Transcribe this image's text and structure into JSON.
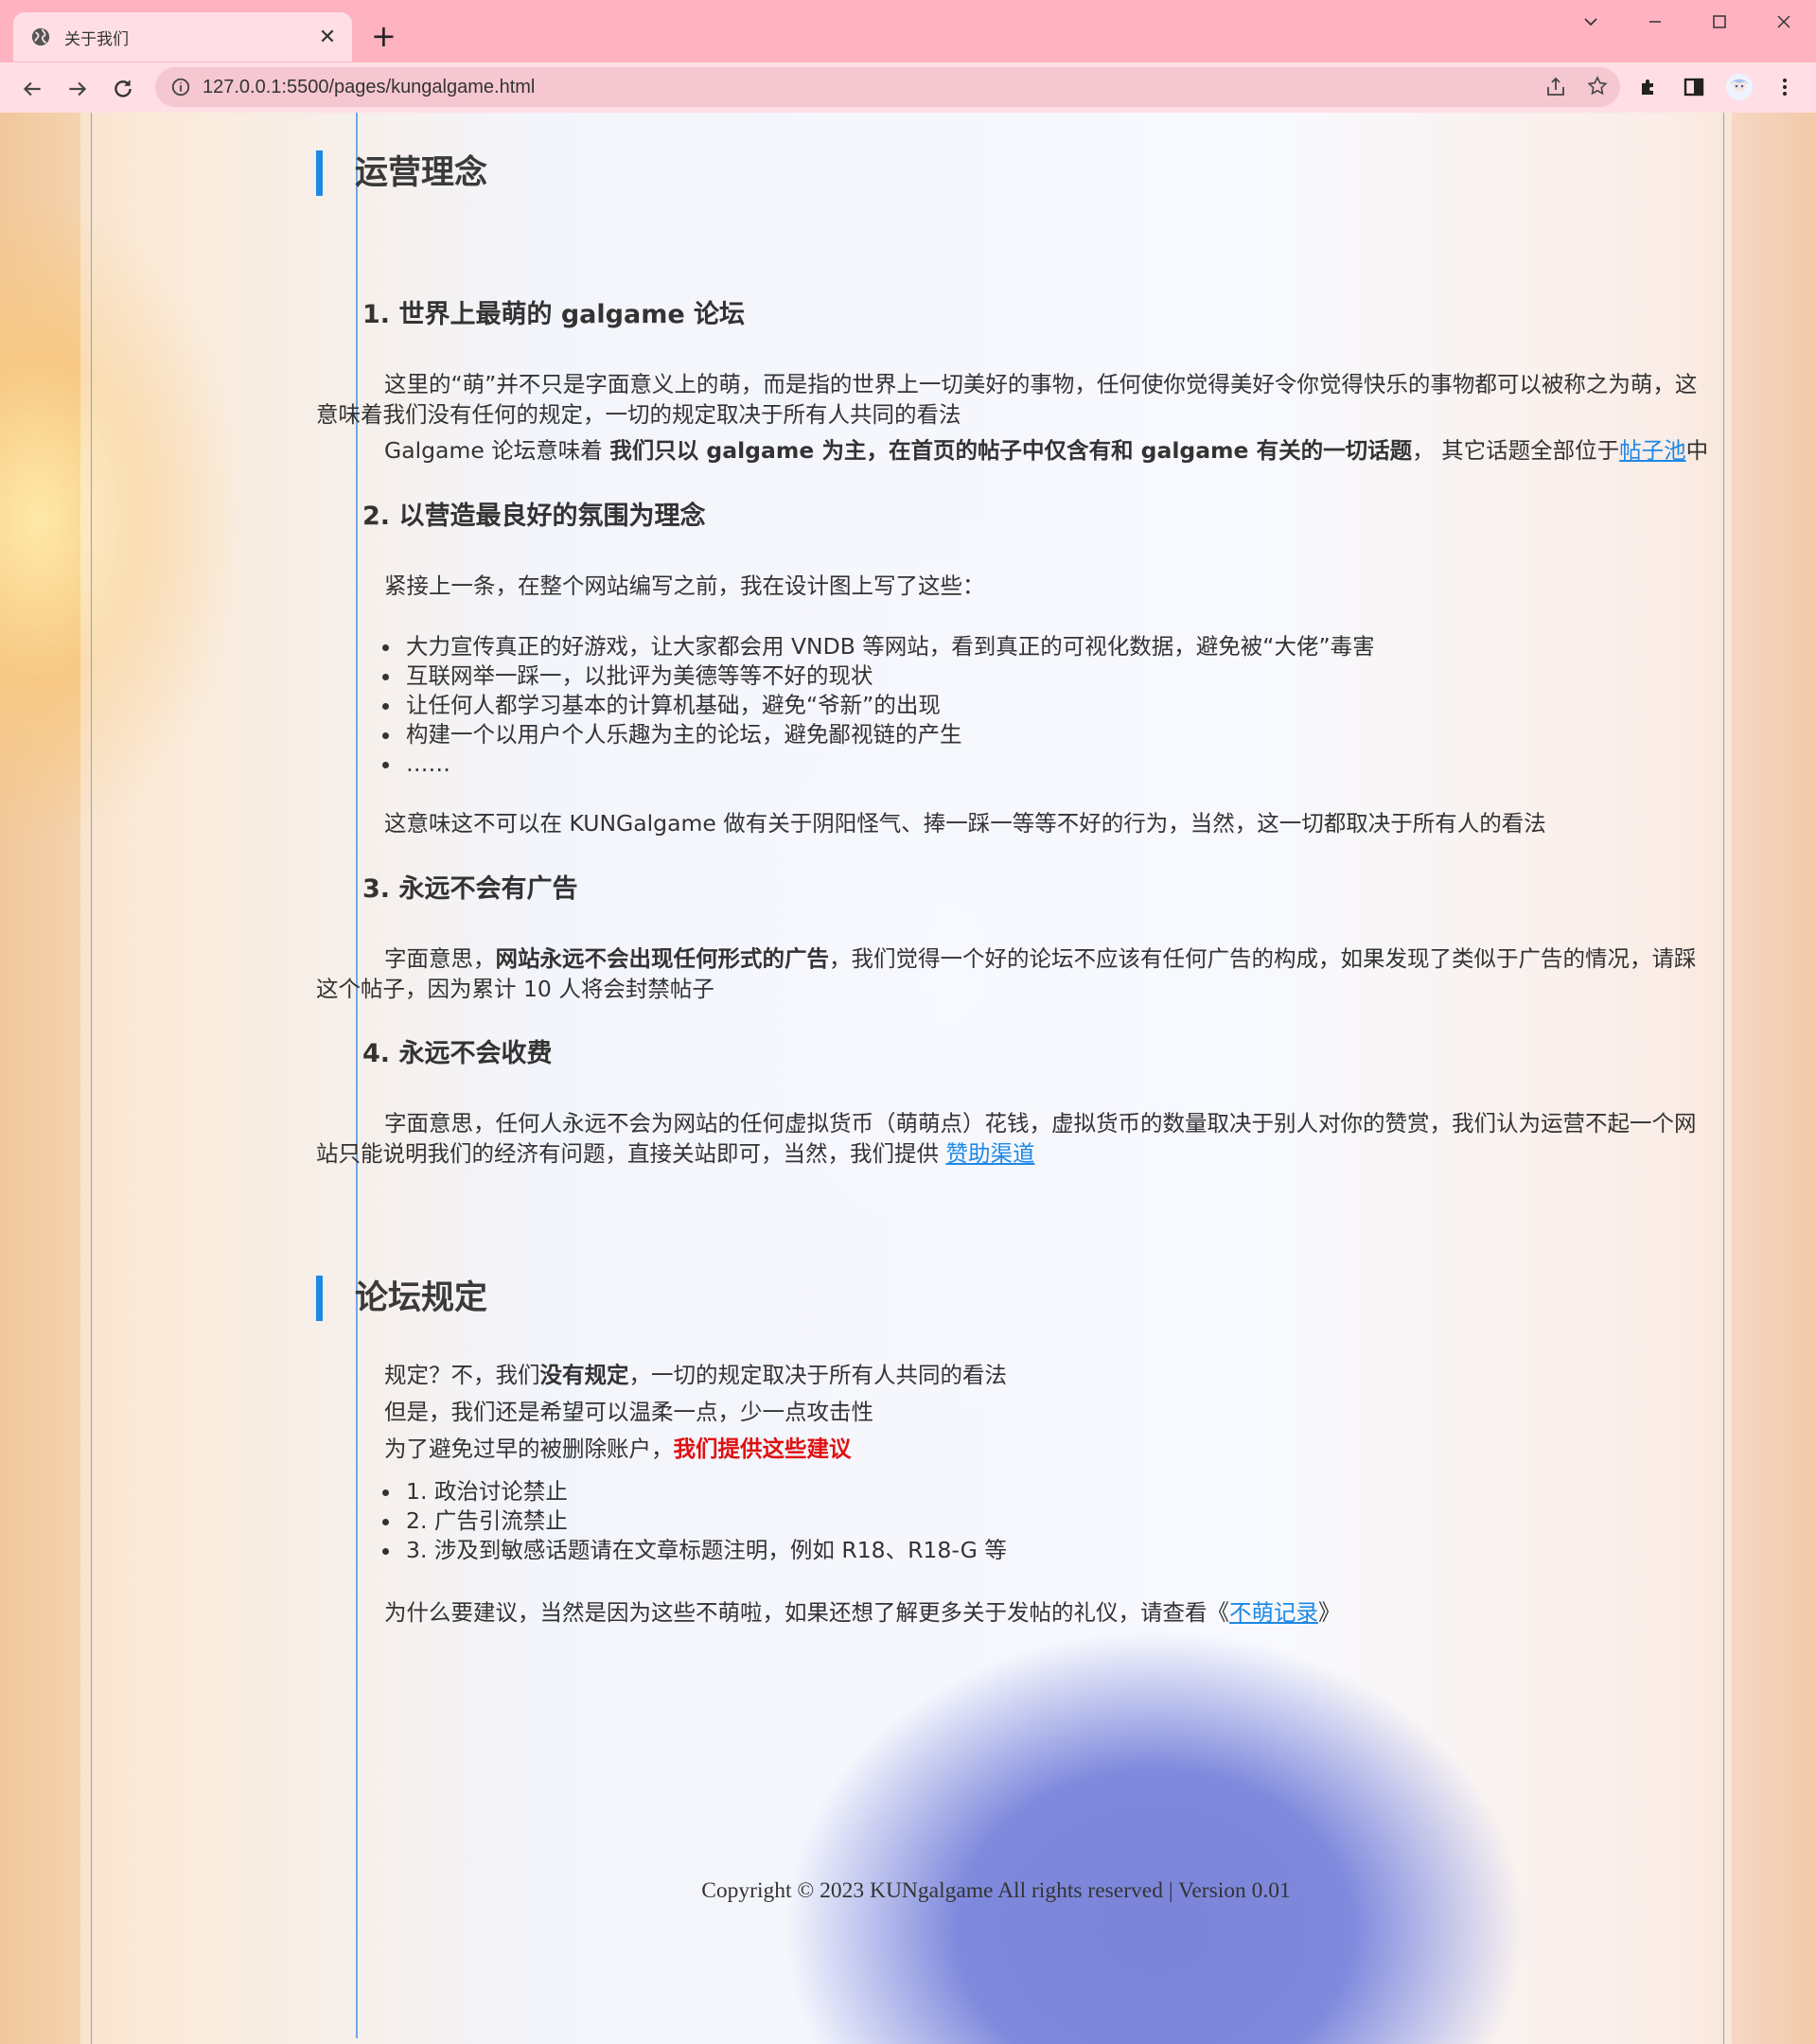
{
  "browser": {
    "tab_title": "关于我们",
    "tab_close": "✕",
    "new_tab": "+",
    "url": "127.0.0.1:5500/pages/kungalgame.html"
  },
  "section1": {
    "title": "运营理念",
    "item1": {
      "heading": "1. 世界上最萌的 galgame 论坛",
      "para": "这里的“萌”并不只是字面意义上的萌，而是指的世界上一切美好的事物，任何使你觉得美好令你觉得快乐的事物都可以被称之为萌，这意味着我们没有任何的规定，一切的规定取决于所有人共同的看法",
      "line_pre": "Galgame 论坛意味着 ",
      "line_bold": "我们只以 galgame 为主，在首页的帖子中仅含有和 galgame 有关的一切话题",
      "line_mid": "， 其它话题全部位于",
      "line_link": "帖子池",
      "line_post": "中"
    },
    "item2": {
      "heading": "2. 以营造最良好的氛围为理念",
      "intro": "紧接上一条，在整个网站编写之前，我在设计图上写了这些：",
      "bullets": [
        "大力宣传真正的好游戏，让大家都会用 VNDB 等网站，看到真正的可视化数据，避免被“大佬”毒害",
        "互联网举一踩一，以批评为美德等等不好的现状",
        "让任何人都学习基本的计算机基础，避免“爷新”的出现",
        "构建一个以用户个人乐趣为主的论坛，避免鄙视链的产生",
        "……"
      ],
      "outro": "这意味这不可以在 KUNGalgame 做有关于阴阳怪气、捧一踩一等等不好的行为，当然，这一切都取决于所有人的看法"
    },
    "item3": {
      "heading": "3. 永远不会有广告",
      "pre": "字面意思，",
      "bold": "网站永远不会出现任何形式的广告",
      "post": "，我们觉得一个好的论坛不应该有任何广告的构成，如果发现了类似于广告的情况，请踩这个帖子，因为累计 10 人将会封禁帖子"
    },
    "item4": {
      "heading": "4. 永远不会收费",
      "pre": "字面意思，任何人永远不会为网站的任何虚拟货币（萌萌点）花钱，虚拟货币的数量取决于别人对你的赞赏，我们认为运营不起一个网站只能说明我们的经济有问题，直接关站即可，当然，我们提供 ",
      "link": "赞助渠道"
    }
  },
  "section2": {
    "title": "论坛规定",
    "line1_pre": "规定？不，我们",
    "line1_bold": "没有规定",
    "line1_post": "，一切的规定取决于所有人共同的看法",
    "line2": "但是，我们还是希望可以温柔一点，少一点攻击性",
    "line3_pre": "为了避免过早的被删除账户，",
    "line3_red": "我们提供这些建议",
    "rules": [
      "1. 政治讨论禁止",
      "2. 广告引流禁止",
      "3. 涉及到敏感话题请在文章标题注明，例如 R18、R18-G 等"
    ],
    "outro_pre": "为什么要建议，当然是因为这些不萌啦，如果还想了解更多关于发帖的礼仪，请查看《",
    "outro_link": "不萌记录",
    "outro_post": "》"
  },
  "footer": "Copyright © 2023 KUNgalgame All rights reserved | Version 0.01",
  "colors": {
    "accent": "#1e88e5",
    "warning": "#e01010",
    "chrome": "#ffb3c1"
  }
}
